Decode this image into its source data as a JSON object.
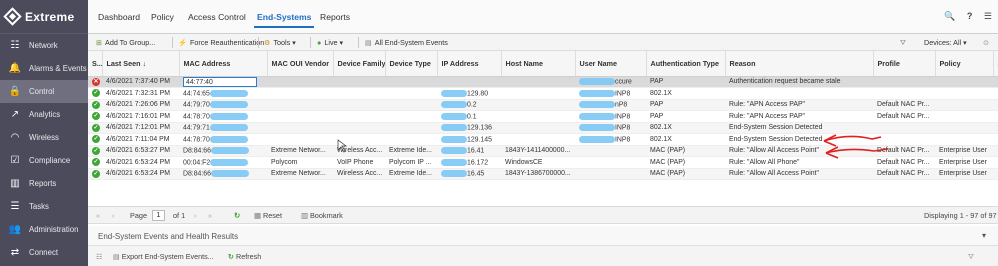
{
  "brand": {
    "name": "Extreme"
  },
  "sidebar": {
    "items": [
      {
        "label": "Network",
        "icon": "network-icon",
        "glyph": "☷"
      },
      {
        "label": "Alarms & Events",
        "icon": "bell-icon",
        "glyph": "🔔"
      },
      {
        "label": "Control",
        "icon": "lock-icon",
        "glyph": "🔒"
      },
      {
        "label": "Analytics",
        "icon": "analytics-icon",
        "glyph": "↗"
      },
      {
        "label": "Wireless",
        "icon": "wifi-icon",
        "glyph": "◠"
      },
      {
        "label": "Compliance",
        "icon": "compliance-icon",
        "glyph": "☑"
      },
      {
        "label": "Reports",
        "icon": "reports-icon",
        "glyph": "▥"
      },
      {
        "label": "Tasks",
        "icon": "tasks-icon",
        "glyph": "☰"
      },
      {
        "label": "Administration",
        "icon": "admin-icon",
        "glyph": "👥"
      },
      {
        "label": "Connect",
        "icon": "connect-icon",
        "glyph": "⇄"
      }
    ],
    "active_index": 2
  },
  "topbar": {
    "tabs": [
      "Dashboard",
      "Policy",
      "Access Control",
      "End-Systems",
      "Reports"
    ],
    "active": "End-Systems",
    "icons": {
      "search": "🔍",
      "help": "?",
      "menu": "☰"
    }
  },
  "toolbar": {
    "add_to_group": "Add To Group...",
    "force_reauth": "Force Reauthentication",
    "tools": "Tools",
    "live": "Live",
    "all_events": "All End-System Events",
    "devices": "Devices: All"
  },
  "table": {
    "columns": [
      "S...",
      "Last Seen",
      "MAC Address",
      "MAC OUI Vendor",
      "Device Family",
      "Device Type",
      "IP Address",
      "Host Name",
      "User Name",
      "Authentication Type",
      "Reason",
      "Profile",
      "Policy",
      "S"
    ],
    "rows": [
      {
        "status": "err",
        "last_seen": "4/6/2021 7:37:40 PM",
        "mac": "44:77:40",
        "vendor": "",
        "family": "",
        "dtype": "",
        "ip": "",
        "host": "",
        "user": "ccure",
        "auth": "PAP",
        "reason": "Authentication request became stale",
        "profile": "",
        "policy": "",
        "selected": true
      },
      {
        "status": "ok",
        "last_seen": "4/6/2021 7:32:31 PM",
        "mac": "44:74:65",
        "vendor": "",
        "family": "",
        "dtype": "",
        "ip": "129.80",
        "host": "",
        "user": "INP8",
        "auth": "802.1X",
        "reason": "",
        "profile": "",
        "policy": ""
      },
      {
        "status": "ok",
        "last_seen": "4/6/2021 7:26:06 PM",
        "mac": "44:79:70",
        "vendor": "",
        "family": "",
        "dtype": "",
        "ip": "0.2",
        "host": "",
        "user": "nP8",
        "auth": "PAP",
        "reason": "Rule: \"APN Access PAP\"",
        "profile": "Default NAC Pr...",
        "policy": ""
      },
      {
        "status": "ok",
        "last_seen": "4/6/2021 7:16:01 PM",
        "mac": "44:78:70",
        "vendor": "",
        "family": "",
        "dtype": "",
        "ip": "0.1",
        "host": "",
        "user": "INP8",
        "auth": "PAP",
        "reason": "Rule: \"APN Access PAP\"",
        "profile": "Default NAC Pr...",
        "policy": ""
      },
      {
        "status": "ok",
        "last_seen": "4/6/2021 7:12:01 PM",
        "mac": "44:79:71",
        "vendor": "",
        "family": "",
        "dtype": "",
        "ip": "129.136",
        "host": "",
        "user": "INP8",
        "auth": "802.1X",
        "reason": "End-System Session Detected",
        "profile": "",
        "policy": ""
      },
      {
        "status": "ok",
        "last_seen": "4/6/2021 7:11:04 PM",
        "mac": "44:78:70",
        "vendor": "",
        "family": "",
        "dtype": "",
        "ip": "129.145",
        "host": "",
        "user": "INP8",
        "auth": "802.1X",
        "reason": "End-System Session Detected",
        "profile": "",
        "policy": ""
      },
      {
        "status": "ok",
        "last_seen": "4/6/2021 6:53:27 PM",
        "mac": "D8:84:66",
        "vendor": "Extreme Networ...",
        "family": "Wireless Acc...",
        "dtype": "Extreme Ide...",
        "ip": "16.41",
        "host": "1843Y-1411400000...",
        "user": "",
        "auth": "MAC (PAP)",
        "reason": "Rule: \"Allow All Access Point\"",
        "profile": "Default NAC Pr...",
        "policy": "Enterprise User"
      },
      {
        "status": "ok",
        "last_seen": "4/6/2021 6:53:24 PM",
        "mac": "00:04:F2",
        "vendor": "Polycom",
        "family": "VoIP Phone",
        "dtype": "Polycom IP ...",
        "ip": "16.172",
        "host": "WindowsCE",
        "user": "",
        "auth": "MAC (PAP)",
        "reason": "Rule: \"Allow All Phone\"",
        "profile": "Default NAC Pr...",
        "policy": "Enterprise User"
      },
      {
        "status": "ok",
        "last_seen": "4/6/2021 6:53:24 PM",
        "mac": "D8:84:66",
        "vendor": "Extreme Networ...",
        "family": "Wireless Acc...",
        "dtype": "Extreme Ide...",
        "ip": "16.45",
        "host": "1843Y-1386700000...",
        "user": "",
        "auth": "MAC (PAP)",
        "reason": "Rule: \"Allow All Access Point\"",
        "profile": "Default NAC Pr...",
        "policy": "Enterprise User"
      }
    ]
  },
  "pager": {
    "page_label": "Page",
    "page_value": "1",
    "of_label": "of 1",
    "reset": "Reset",
    "bookmark": "Bookmark",
    "displaying": "Displaying 1 - 97 of 97"
  },
  "events": {
    "title": "End-System Events and Health Results",
    "export": "Export End-System Events...",
    "refresh": "Refresh"
  },
  "colors": {
    "accent": "#1f6fbf",
    "sidebar": "#4b4b5b",
    "ok": "#3ea636",
    "error": "#d9352b",
    "annotation": "#e02020"
  }
}
